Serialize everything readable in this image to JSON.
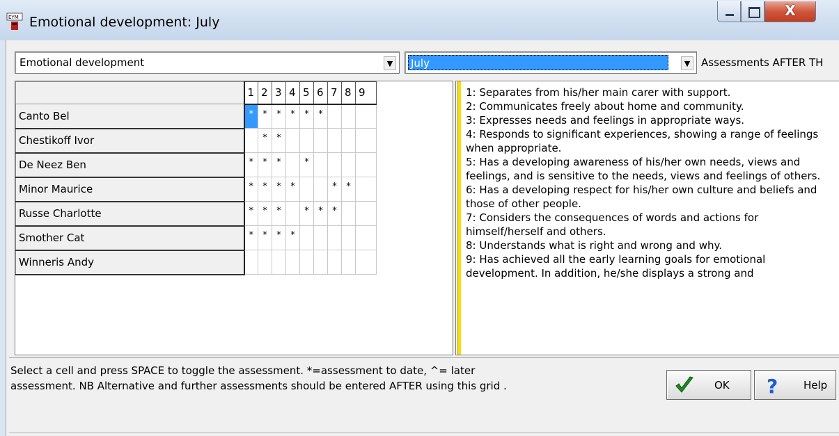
{
  "window": {
    "title": "Emotional development: July",
    "close_label": "X"
  },
  "filters": {
    "area_value": "Emotional development",
    "month_value": "July",
    "after_label": "Assessments AFTER TH"
  },
  "grid": {
    "columns": [
      "1",
      "2",
      "3",
      "4",
      "5",
      "6",
      "7",
      "8",
      "9"
    ],
    "rows": [
      {
        "name": "Canto Bel",
        "marks": [
          "*",
          "*",
          "*",
          "*",
          "*",
          "*",
          "",
          "",
          ""
        ]
      },
      {
        "name": "Chestikoff Ivor",
        "marks": [
          "",
          "*",
          "*",
          "",
          "",
          "",
          "",
          "",
          ""
        ]
      },
      {
        "name": "De Neez Ben",
        "marks": [
          "*",
          "*",
          "*",
          "",
          "*",
          "",
          "",
          "",
          ""
        ]
      },
      {
        "name": "Minor Maurice",
        "marks": [
          "*",
          "*",
          "*",
          "*",
          "",
          "",
          "*",
          "*",
          ""
        ]
      },
      {
        "name": "Russe Charlotte",
        "marks": [
          "*",
          "*",
          "*",
          "",
          "*",
          "*",
          "*",
          "",
          ""
        ]
      },
      {
        "name": "Smother Cat",
        "marks": [
          "*",
          "*",
          "*",
          "*",
          "",
          "",
          "",
          "",
          ""
        ]
      },
      {
        "name": "Winneris Andy",
        "marks": [
          "",
          "",
          "",
          "",
          "",
          "",
          "",
          "",
          ""
        ]
      }
    ]
  },
  "descriptions": [
    "1: Separates from his/her main carer with support.",
    "2: Communicates freely about home and community.",
    "3: Expresses needs and feelings in appropriate ways.",
    "4: Responds to significant experiences, showing a range of feelings when appropriate.",
    "5: Has a developing awareness of his/her own needs, views and feelings, and is sensitive to the needs, views and feelings of others.",
    "6: Has a developing respect for his/her own culture and beliefs and those of other people.",
    "7: Considers the consequences of words and actions for himself/herself and others.",
    "8: Understands what is right and wrong and why.",
    "9: Has achieved all the early learning goals for emotional development.  In addition, he/she displays a strong and"
  ],
  "footer": {
    "hint_line1": "Select a cell and press SPACE to toggle the assessment.  *=assessment to date, ^= later",
    "hint_line2": "assessment. NB Alternative and further assessments should be entered AFTER using this grid ."
  },
  "buttons": {
    "ok_label": "OK",
    "help_label": "Help"
  },
  "colors": {
    "selection": "#3399ff",
    "divider": "#f6e000",
    "ok_check": "#1f8a1f",
    "help_question": "#1a5fd0"
  }
}
